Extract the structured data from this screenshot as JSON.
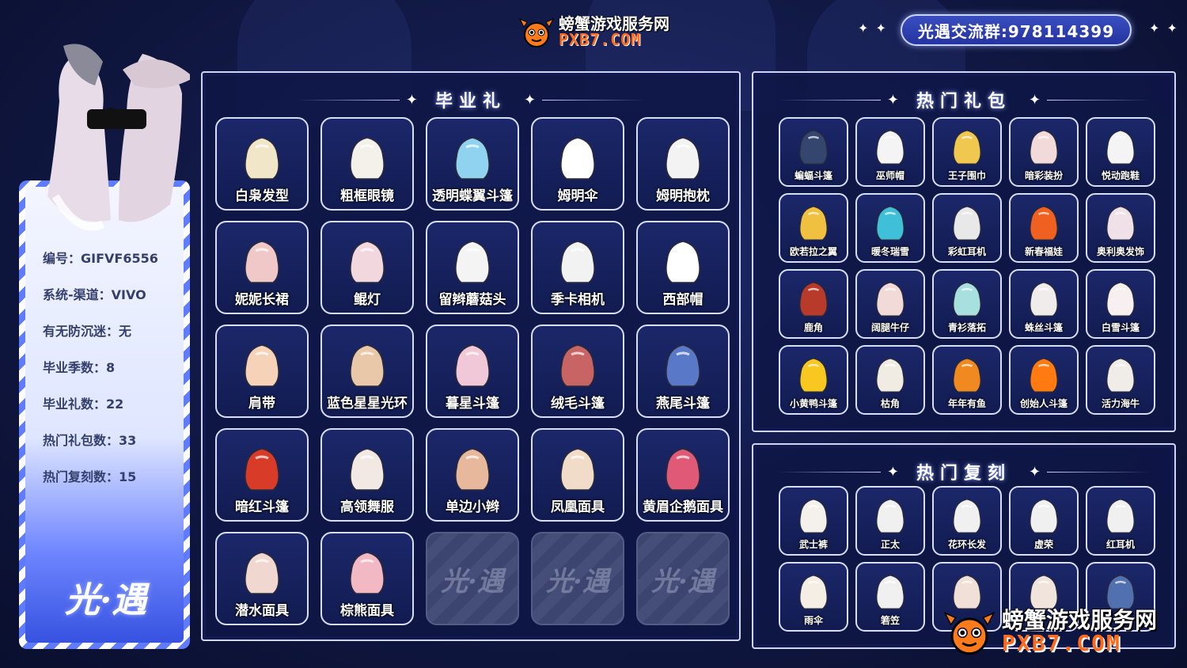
{
  "brand": {
    "name": "螃蟹游戏服务网",
    "domain": "PXB7.COM"
  },
  "watermark": {
    "name": "螃蟹游戏服务网",
    "domain": "PXB7.COM"
  },
  "group": {
    "label": "光遇交流群:978114399"
  },
  "decor": {
    "stars_left": "✦ ✦",
    "stars_right": "✦ ✦"
  },
  "account": {
    "rows": [
      {
        "key": "编号：",
        "value": "GIFVF6556"
      },
      {
        "key": "系统-渠道：",
        "value": "VIVO"
      },
      {
        "key": "有无防沉迷：",
        "value": "无"
      },
      {
        "key": "毕业季数：",
        "value": "8"
      },
      {
        "key": "毕业礼数：",
        "value": "22"
      },
      {
        "key": "热门礼包数：",
        "value": "33"
      },
      {
        "key": "热门复刻数：",
        "value": "15"
      }
    ],
    "logo": "光·遇"
  },
  "graduation": {
    "title": "毕业礼",
    "items": [
      {
        "label": "白枭发型",
        "icon": "hair-icon",
        "color": "#f2e6c8"
      },
      {
        "label": "粗框眼镜",
        "icon": "glasses-icon",
        "color": "#f4f0ea"
      },
      {
        "label": "透明蝶翼斗篷",
        "icon": "butterfly-cape-icon",
        "color": "#8fd3f0"
      },
      {
        "label": "姆明伞",
        "icon": "umbrella-icon",
        "color": "#ffffff"
      },
      {
        "label": "姆明抱枕",
        "icon": "moomin-pillow-icon",
        "color": "#f3f3f3"
      },
      {
        "label": "妮妮长裙",
        "icon": "dress-icon",
        "color": "#f0c8c8"
      },
      {
        "label": "鲲灯",
        "icon": "lantern-icon",
        "color": "#f2d7df"
      },
      {
        "label": "留辫蘑菇头",
        "icon": "mushroom-hair-icon",
        "color": "#f4f4f4"
      },
      {
        "label": "季卡相机",
        "icon": "camera-icon",
        "color": "#f2f2f2"
      },
      {
        "label": "西部帽",
        "icon": "cowboy-hat-icon",
        "color": "#ffffff"
      },
      {
        "label": "肩带",
        "icon": "shoulder-strap-icon",
        "color": "#f5d2b8"
      },
      {
        "label": "蓝色星星光环",
        "icon": "star-halo-icon",
        "color": "#e8c8a8"
      },
      {
        "label": "暮星斗篷",
        "icon": "dusk-cape-icon",
        "color": "#f0c8d8"
      },
      {
        "label": "绒毛斗篷",
        "icon": "fur-cape-icon",
        "color": "#c86464"
      },
      {
        "label": "燕尾斗篷",
        "icon": "swallowtail-cape-icon",
        "color": "#5a78c8"
      },
      {
        "label": "暗红斗篷",
        "icon": "red-cape-icon",
        "color": "#d83c28"
      },
      {
        "label": "高领舞服",
        "icon": "dance-outfit-icon",
        "color": "#f2e8e4"
      },
      {
        "label": "单边小辫",
        "icon": "braid-icon",
        "color": "#e8b89c"
      },
      {
        "label": "凤凰面具",
        "icon": "phoenix-mask-icon",
        "color": "#f0dcc8"
      },
      {
        "label": "黄眉企鹅面具",
        "icon": "penguin-mask-icon",
        "color": "#e05a78"
      },
      {
        "label": "潜水面具",
        "icon": "diving-mask-icon",
        "color": "#f0d8d0"
      },
      {
        "label": "棕熊面具",
        "icon": "bear-mask-icon",
        "color": "#f2b8c4"
      }
    ],
    "placeholder": "光·遇"
  },
  "hot_packs": {
    "title": "热门礼包",
    "items": [
      {
        "label": "蝙蝠斗篷",
        "icon": "bat-cape-icon",
        "color": "#34466e"
      },
      {
        "label": "巫师帽",
        "icon": "witch-hat-icon",
        "color": "#f4f4f4"
      },
      {
        "label": "王子围巾",
        "icon": "prince-scarf-icon",
        "color": "#f0c850"
      },
      {
        "label": "暗彩装扮",
        "icon": "outfit-icon",
        "color": "#f2dada"
      },
      {
        "label": "悦动跑鞋",
        "icon": "sneaker-icon",
        "color": "#f4f4f4"
      },
      {
        "label": "欧若拉之翼",
        "icon": "aurora-wings-icon",
        "color": "#f0c040"
      },
      {
        "label": "暖冬瑞雪",
        "icon": "snow-cape-icon",
        "color": "#40c0d8"
      },
      {
        "label": "彩虹耳机",
        "icon": "headphones-icon",
        "color": "#e8e8e8"
      },
      {
        "label": "新春福娃",
        "icon": "lucky-doll-icon",
        "color": "#f06020"
      },
      {
        "label": "奥利奥发饰",
        "icon": "oreo-ears-icon",
        "color": "#f0e0e8"
      },
      {
        "label": "鹿角",
        "icon": "antler-icon",
        "color": "#b83a2a"
      },
      {
        "label": "阔腿牛仔",
        "icon": "jeans-icon",
        "color": "#f2dad8"
      },
      {
        "label": "青衫落拓",
        "icon": "green-robe-icon",
        "color": "#a8e0e0"
      },
      {
        "label": "蛛丝斗篷",
        "icon": "spider-cape-icon",
        "color": "#f0ecec"
      },
      {
        "label": "白雪斗篷",
        "icon": "snow-white-cape-icon",
        "color": "#f8f0f0"
      },
      {
        "label": "小黄鸭斗篷",
        "icon": "duck-cape-icon",
        "color": "#f8c820"
      },
      {
        "label": "枯角",
        "icon": "dry-horn-icon",
        "color": "#f0ece4"
      },
      {
        "label": "年年有鱼",
        "icon": "fish-icon",
        "color": "#f08a20"
      },
      {
        "label": "创始人斗篷",
        "icon": "founder-cape-icon",
        "color": "#ff7a10"
      },
      {
        "label": "活力海牛",
        "icon": "manatee-icon",
        "color": "#f0ece8"
      }
    ]
  },
  "hot_reruns": {
    "title": "热门复刻",
    "items": [
      {
        "label": "武士裤",
        "icon": "samurai-pants-icon",
        "color": "#f4f0ec"
      },
      {
        "label": "正太",
        "icon": "short-hair-icon",
        "color": "#f0f0f0"
      },
      {
        "label": "花环长发",
        "icon": "flower-hair-icon",
        "color": "#f0f0f0"
      },
      {
        "label": "虚荣",
        "icon": "long-hair-icon",
        "color": "#f0f0f0"
      },
      {
        "label": "红耳机",
        "icon": "red-headphones-icon",
        "color": "#f0f0f0"
      },
      {
        "label": "雨伞",
        "icon": "rain-umbrella-icon",
        "color": "#f4eee4"
      },
      {
        "label": "箬笠",
        "icon": "straw-hat-icon",
        "color": "#f0f0f0"
      },
      {
        "label": "",
        "icon": "cape-icon",
        "color": "#f0e0d8"
      },
      {
        "label": "",
        "icon": "outfit-icon",
        "color": "#f0e4dc"
      },
      {
        "label": "",
        "icon": "blue-cape-icon",
        "color": "#5070b0"
      }
    ]
  }
}
